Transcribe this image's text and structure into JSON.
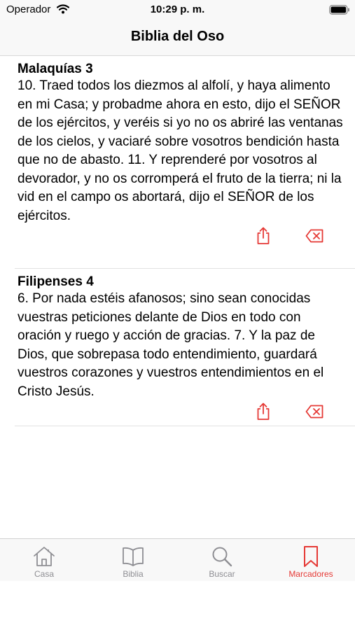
{
  "colors": {
    "accent": "#e53935",
    "inactive": "#8e8e93"
  },
  "status_bar": {
    "carrier": "Operador",
    "time": "10:29 p. m."
  },
  "nav": {
    "title": "Biblia del Oso"
  },
  "bookmarks": [
    {
      "reference": "Malaquías 3",
      "text": "10. Traed todos los diezmos al alfolí, y haya alimento en mi Casa; y probadme ahora en esto, dijo el SEÑOR de los ejércitos, y veréis si yo no os abriré las ventanas de los cielos, y vaciaré sobre vosotros bendición hasta que no de abasto. 11. Y reprenderé por vosotros al devorador, y no os corromperá el fruto de la tierra; ni la vid en el campo os abortará, dijo el SEÑOR de los ejércitos.",
      "actions": {
        "share_icon": "share-icon",
        "delete_icon": "delete-icon"
      }
    },
    {
      "reference": "Filipenses 4",
      "text": "6. Por nada estéis afanosos; sino sean conocidas vuestras peticiones delante de Dios en todo con oración y ruego y acción de gracias. 7. Y la paz de Dios, que sobrepasa todo entendimiento, guardará vuestros corazones y vuestros entendimientos en el Cristo Jesús.",
      "actions": {
        "share_icon": "share-icon",
        "delete_icon": "delete-icon"
      }
    }
  ],
  "tabs": [
    {
      "label": "Casa",
      "icon": "house-icon",
      "active": false
    },
    {
      "label": "Biblia",
      "icon": "book-icon",
      "active": false
    },
    {
      "label": "Buscar",
      "icon": "search-icon",
      "active": false
    },
    {
      "label": "Marcadores",
      "icon": "bookmark-icon",
      "active": true
    }
  ]
}
